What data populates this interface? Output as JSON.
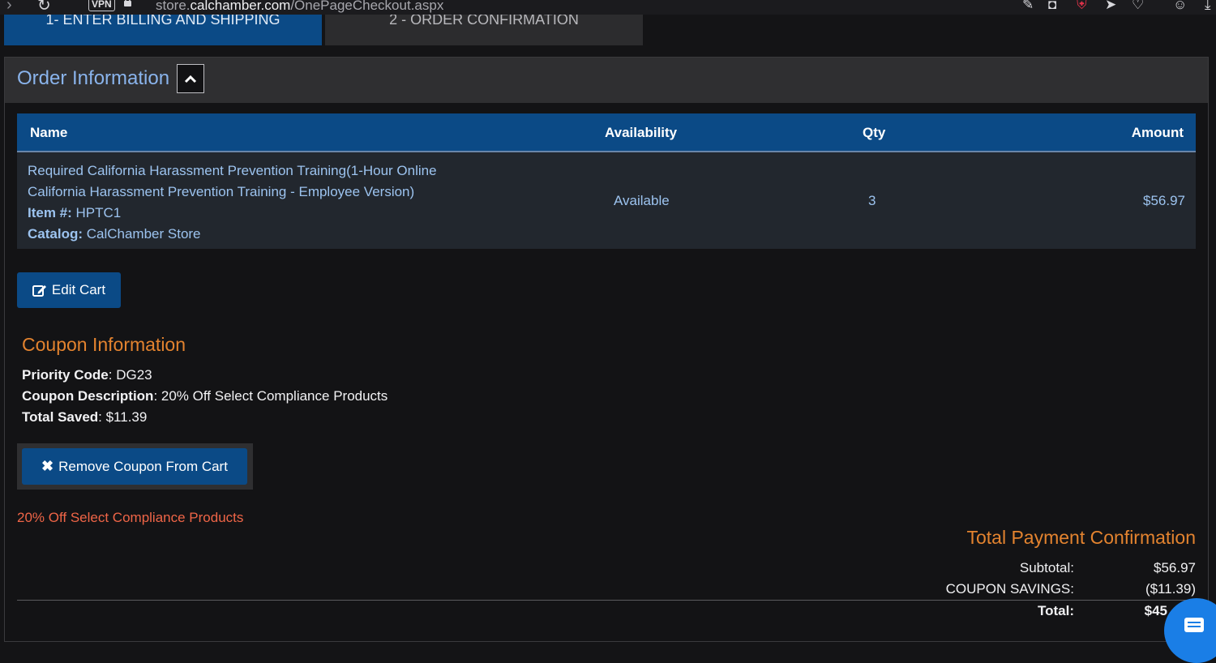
{
  "browser": {
    "url_prefix": "store.",
    "url_domain": "calchamber.com",
    "url_path": "/OnePageCheckout.aspx",
    "vpn_label": "VPN"
  },
  "tabs": [
    {
      "label": "1- ENTER BILLING AND SHIPPING"
    },
    {
      "label": "2 - ORDER CONFIRMATION"
    }
  ],
  "order_panel": {
    "title": "Order Information",
    "columns": {
      "name": "Name",
      "availability": "Availability",
      "qty": "Qty",
      "amount": "Amount"
    },
    "items": [
      {
        "name_line1": "Required California Harassment Prevention Training(1-Hour Online",
        "name_line2": "California Harassment Prevention Training - Employee Version)",
        "item_label": "Item #:",
        "item_number": "HPTC1",
        "catalog_label": "Catalog:",
        "catalog": "CalChamber Store",
        "availability": "Available",
        "qty": "3",
        "amount": "$56.97"
      }
    ],
    "edit_cart_label": "Edit Cart"
  },
  "coupon": {
    "title": "Coupon Information",
    "priority_code_label": "Priority Code",
    "priority_code": ": DG23",
    "description_label": "Coupon Description",
    "description": ": 20% Off Select Compliance Products",
    "total_saved_label": "Total Saved",
    "total_saved": ": $11.39",
    "remove_label": "Remove Coupon From Cart",
    "applied_note": "20% Off Select Compliance Products"
  },
  "totals": {
    "title": "Total Payment Confirmation",
    "subtotal_label": "Subtotal:",
    "subtotal": "$56.97",
    "savings_label": "COUPON SAVINGS:",
    "savings": "($11.39)",
    "total_label": "Total:",
    "total": "$45"
  },
  "colors": {
    "accent_blue": "#0b4a86",
    "link_blue": "#8ab4ec",
    "heading_orange": "#e3832f",
    "note_red": "#ef6547",
    "chat_blue": "#1a7ee6"
  }
}
